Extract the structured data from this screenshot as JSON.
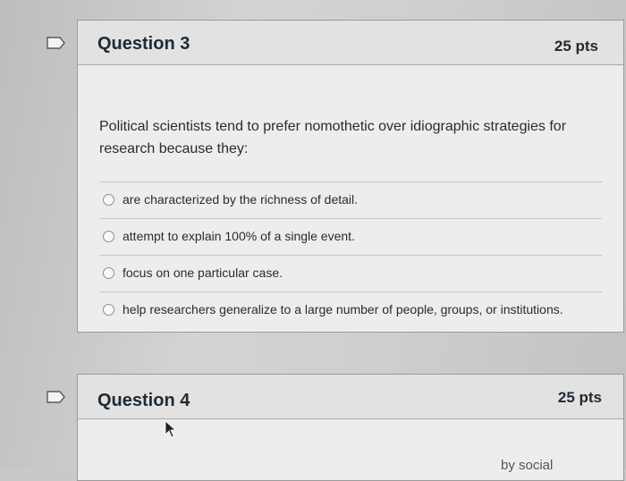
{
  "questions": [
    {
      "title": "Question 3",
      "points": "25 pts",
      "text": "Political scientists tend to prefer nomothetic over idiographic strategies for research because they:",
      "answers": [
        "are characterized by the richness of detail.",
        "attempt to explain 100% of a single event.",
        "focus on one particular case.",
        "help researchers generalize to a large number of people, groups, or institutions."
      ]
    },
    {
      "title": "Question 4",
      "points": "25 pts",
      "partial_text": "by social"
    }
  ],
  "icons": {
    "flag": "flag-icon",
    "cursor": "mouse-pointer-icon"
  },
  "colors": {
    "page_background": "#c9c9c9",
    "card_background": "#ededed",
    "header_background": "#e2e2e2",
    "text": "#1f2a33"
  }
}
